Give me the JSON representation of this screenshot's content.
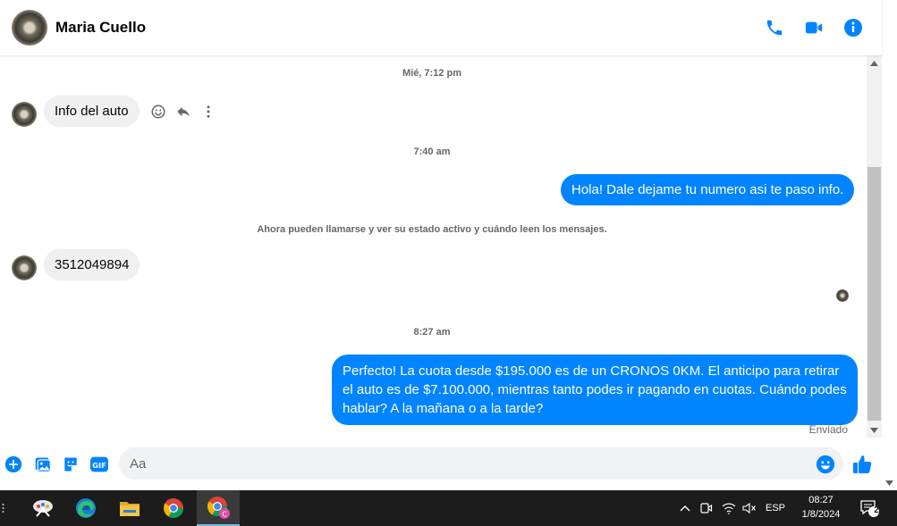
{
  "header": {
    "contact_name": "Maria Cuello",
    "icons": [
      "phone-icon",
      "video-camera-icon",
      "info-icon"
    ],
    "accent_color": "#0084ff"
  },
  "chat": {
    "timestamps": [
      "Mié, 7:12 pm",
      "7:40 am",
      "8:27 am"
    ],
    "messages": {
      "in_1": "Info del auto",
      "out_1": "Hola! Dale dejame tu numero  asi te paso info.",
      "system": "Ahora pueden llamarse y ver su estado activo y cuándo leen los mensajes.",
      "in_2": "3512049894",
      "out_2": "Perfecto! La cuota desde $195.000 es de un CRONOS 0KM. El anticipo para retirar el auto es de $7.100.000, mientras tanto podes ir pagando en cuotas. Cuándo podes hablar? A la mañana o a la tarde?"
    },
    "status": "Enviado"
  },
  "composer": {
    "placeholder": "Aa",
    "icons": [
      "add-icon",
      "photo-icon",
      "sticker-icon",
      "gif-icon",
      "emoji-icon",
      "like-icon"
    ]
  },
  "taskbar": {
    "apps": [
      "snipping-tool-icon",
      "edge-icon",
      "file-explorer-icon",
      "chrome-icon",
      "chrome-profile-icon"
    ],
    "language": "ESP",
    "time": "08:27",
    "date": "1/8/2024",
    "notification_count": "2"
  }
}
